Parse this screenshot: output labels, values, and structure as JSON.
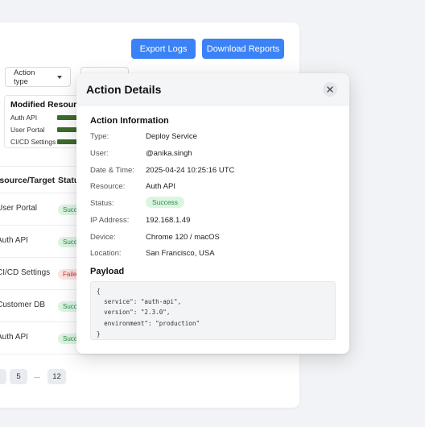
{
  "toolbar": {
    "export_label": "Export Logs",
    "download_label": "Download Reports"
  },
  "filters": {
    "action_type_label": "Action type"
  },
  "modified_resources": {
    "title": "Modified Resources",
    "items": [
      {
        "label": "Auth API",
        "level": 1.0
      },
      {
        "label": "User Portal",
        "level": 1.0
      },
      {
        "label": "CI/CD Settings",
        "level": 1.0
      }
    ],
    "bar_color": "#3b6b2e"
  },
  "table": {
    "headers": [
      "Resource/Target",
      "Status"
    ],
    "rows": [
      {
        "resource": "User Portal",
        "status": "Success",
        "status_type": "ok"
      },
      {
        "resource": "Auth API",
        "status": "Success",
        "status_type": "ok"
      },
      {
        "resource": "CI/CD Settings",
        "status": "Failed",
        "status_type": "fail"
      },
      {
        "resource": "Customer DB",
        "status": "Success",
        "status_type": "ok"
      },
      {
        "resource": "Auth API",
        "status": "Success",
        "status_type": "ok"
      }
    ]
  },
  "pagination": {
    "pages": [
      "5",
      "12"
    ],
    "ellipsis": "..."
  },
  "modal": {
    "title": "Action Details",
    "info_title": "Action Information",
    "fields": [
      {
        "key": "Type:",
        "value": "Deploy Service"
      },
      {
        "key": "User:",
        "value": "@anika.singh"
      },
      {
        "key": "Date & Time:",
        "value": "2025-04-24 10:25:16 UTC"
      },
      {
        "key": "Resource:",
        "value": "Auth API"
      },
      {
        "key": "Status:",
        "value": "Success"
      },
      {
        "key": "IP Address:",
        "value": "192.168.1.49"
      },
      {
        "key": "Device:",
        "value": "Chrome 120 / macOS"
      },
      {
        "key": "Location:",
        "value": "San Francisco, USA"
      }
    ],
    "payload_title": "Payload",
    "payload_lines": [
      "{",
      "  service\": \"auth-api\",",
      "  version\": \"2.3.0\",",
      "  environment\": \"production\"",
      "}"
    ]
  },
  "colors": {
    "primary": "#3b82f6",
    "success_bg": "#dcf5e3",
    "success_text": "#2f8a4a",
    "fail_bg": "#fde3e3",
    "fail_text": "#c0392b"
  }
}
